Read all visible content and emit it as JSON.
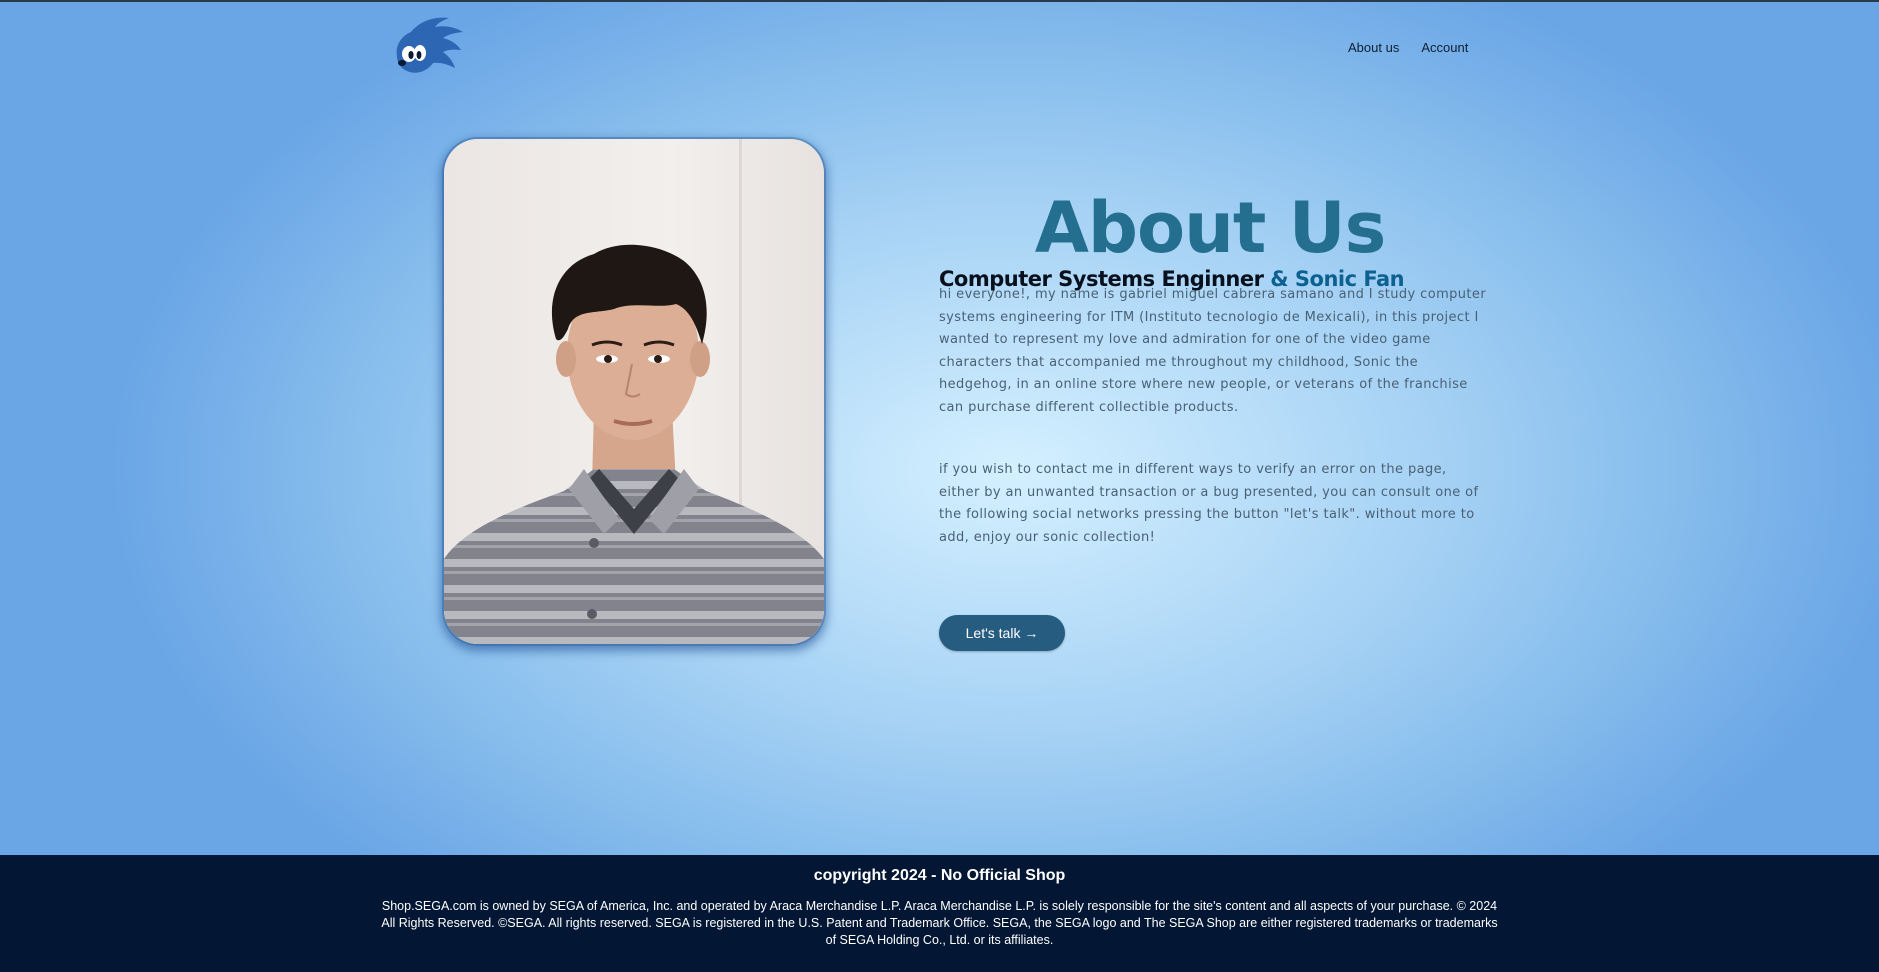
{
  "brand": {
    "logo_icon": "sonic-head-icon",
    "color": "#2d66b3"
  },
  "nav": {
    "about_label": "About us",
    "account_label": "Account"
  },
  "hero": {
    "photo_alt": "Portrait photo"
  },
  "about": {
    "title": "About Us",
    "subtitle_main": "Computer Systems Enginner",
    "subtitle_accent": "& Sonic Fan",
    "paragraph1": "hi everyone!, my name is gabriel miguel cabrera samano and I study computer systems engineering for ITM (Instituto tecnologio de Mexicali), in this project I wanted to represent my love and admiration for one of the video game characters that accompanied me throughout my childhood, Sonic the hedgehog, in an online store where new people, or veterans of the franchise can purchase different collectible products.",
    "paragraph2": "if you wish to contact me in different ways to verify an error on the page, either by an unwanted transaction or a bug presented, you can consult one of the following social networks pressing the button \"let's talk\". without more to add, enjoy our sonic collection!",
    "cta_label": "Let's talk →"
  },
  "footer": {
    "title": "copyright 2024 - No Official Shop",
    "text": "Shop.SEGA.com is owned by SEGA of America, Inc. and operated by Araca Merchandise L.P. Araca Merchandise L.P. is solely responsible for the site's content and all aspects of your purchase. © 2024 All Rights Reserved. ©SEGA. All rights reserved. SEGA is registered in the U.S. Patent and Trademark Office. SEGA, the SEGA logo and The SEGA Shop are either registered trademarks or trademarks of SEGA Holding Co., Ltd. or its affiliates."
  },
  "colors": {
    "title": "#246f8f",
    "accent": "#0d6190",
    "button": "#255c80",
    "footer_bg": "#031633"
  }
}
